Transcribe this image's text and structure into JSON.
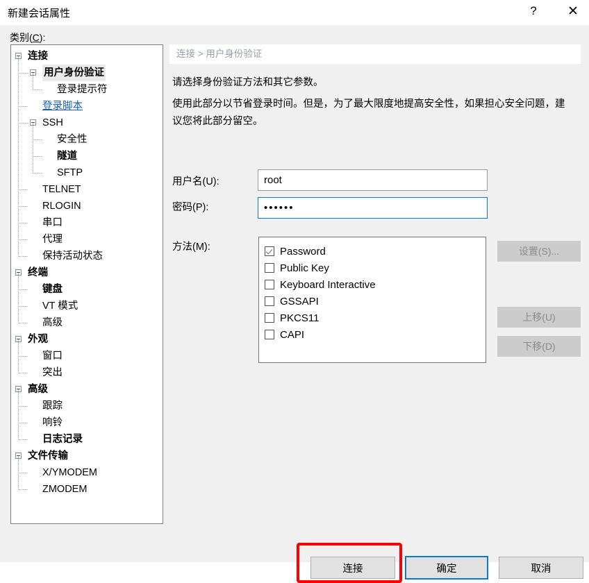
{
  "window": {
    "title": "新建会话属性",
    "help_icon": "question-mark-icon",
    "close_icon": "close-icon"
  },
  "category": {
    "label_prefix": "类别(",
    "label_key": "C",
    "label_suffix": "):"
  },
  "tree": {
    "items": [
      {
        "label": "连接",
        "level": 0,
        "bold": true,
        "expander": true,
        "selected": false,
        "link": false
      },
      {
        "label": "用户身份验证",
        "level": 1,
        "bold": true,
        "expander": true,
        "selected": true,
        "link": false
      },
      {
        "label": "登录提示符",
        "level": 2,
        "bold": false,
        "expander": false,
        "selected": false,
        "link": false
      },
      {
        "label": "登录脚本",
        "level": 1,
        "bold": false,
        "expander": false,
        "selected": false,
        "link": true
      },
      {
        "label": "SSH",
        "level": 1,
        "bold": false,
        "expander": true,
        "selected": false,
        "link": false
      },
      {
        "label": "安全性",
        "level": 2,
        "bold": false,
        "expander": false,
        "selected": false,
        "link": false
      },
      {
        "label": "隧道",
        "level": 2,
        "bold": true,
        "expander": false,
        "selected": false,
        "link": false
      },
      {
        "label": "SFTP",
        "level": 2,
        "bold": false,
        "expander": false,
        "selected": false,
        "link": false
      },
      {
        "label": "TELNET",
        "level": 1,
        "bold": false,
        "expander": false,
        "selected": false,
        "link": false
      },
      {
        "label": "RLOGIN",
        "level": 1,
        "bold": false,
        "expander": false,
        "selected": false,
        "link": false
      },
      {
        "label": "串口",
        "level": 1,
        "bold": false,
        "expander": false,
        "selected": false,
        "link": false
      },
      {
        "label": "代理",
        "level": 1,
        "bold": false,
        "expander": false,
        "selected": false,
        "link": false
      },
      {
        "label": "保持活动状态",
        "level": 1,
        "bold": false,
        "expander": false,
        "selected": false,
        "link": false
      },
      {
        "label": "终端",
        "level": 0,
        "bold": true,
        "expander": true,
        "selected": false,
        "link": false
      },
      {
        "label": "键盘",
        "level": 1,
        "bold": true,
        "expander": false,
        "selected": false,
        "link": false
      },
      {
        "label": "VT 模式",
        "level": 1,
        "bold": false,
        "expander": false,
        "selected": false,
        "link": false
      },
      {
        "label": "高级",
        "level": 1,
        "bold": false,
        "expander": false,
        "selected": false,
        "link": false
      },
      {
        "label": "外观",
        "level": 0,
        "bold": true,
        "expander": true,
        "selected": false,
        "link": false
      },
      {
        "label": "窗口",
        "level": 1,
        "bold": false,
        "expander": false,
        "selected": false,
        "link": false
      },
      {
        "label": "突出",
        "level": 1,
        "bold": false,
        "expander": false,
        "selected": false,
        "link": false
      },
      {
        "label": "高级",
        "level": 0,
        "bold": true,
        "expander": true,
        "selected": false,
        "link": false
      },
      {
        "label": "跟踪",
        "level": 1,
        "bold": false,
        "expander": false,
        "selected": false,
        "link": false
      },
      {
        "label": "响铃",
        "level": 1,
        "bold": false,
        "expander": false,
        "selected": false,
        "link": false
      },
      {
        "label": "日志记录",
        "level": 1,
        "bold": true,
        "expander": false,
        "selected": false,
        "link": false
      },
      {
        "label": "文件传输",
        "level": 0,
        "bold": true,
        "expander": true,
        "selected": false,
        "link": false
      },
      {
        "label": "X/YMODEM",
        "level": 1,
        "bold": false,
        "expander": false,
        "selected": false,
        "link": false
      },
      {
        "label": "ZMODEM",
        "level": 1,
        "bold": false,
        "expander": false,
        "selected": false,
        "link": false
      }
    ]
  },
  "content": {
    "breadcrumb": "连接 > 用户身份验证",
    "description_1": "请选择身份验证方法和其它参数。",
    "description_2": "使用此部分以节省登录时间。但是，为了最大限度地提高安全性，如果担心安全问题，建议您将此部分留空。",
    "username_label": "用户名(U):",
    "username_value": "root",
    "password_label": "密码(P):",
    "password_value": "••••••",
    "password_char_count": 6,
    "method_label": "方法(M):",
    "methods": [
      {
        "label": "Password",
        "checked": true
      },
      {
        "label": "Public Key",
        "checked": false
      },
      {
        "label": "Keyboard Interactive",
        "checked": false
      },
      {
        "label": "GSSAPI",
        "checked": false
      },
      {
        "label": "PKCS11",
        "checked": false
      },
      {
        "label": "CAPI",
        "checked": false
      }
    ],
    "side_buttons": {
      "settings": "设置(S)...",
      "move_up": "上移(U)",
      "move_down": "下移(D)"
    }
  },
  "footer": {
    "connect": "连接",
    "ok": "确定",
    "cancel": "取消"
  },
  "colors": {
    "accent_blue": "#0a78d4",
    "link_blue": "#1a5fb4",
    "highlight_red": "#fe0000",
    "dialog_bg": "#f0f0f0",
    "disabled_text": "#8a8a8a"
  }
}
